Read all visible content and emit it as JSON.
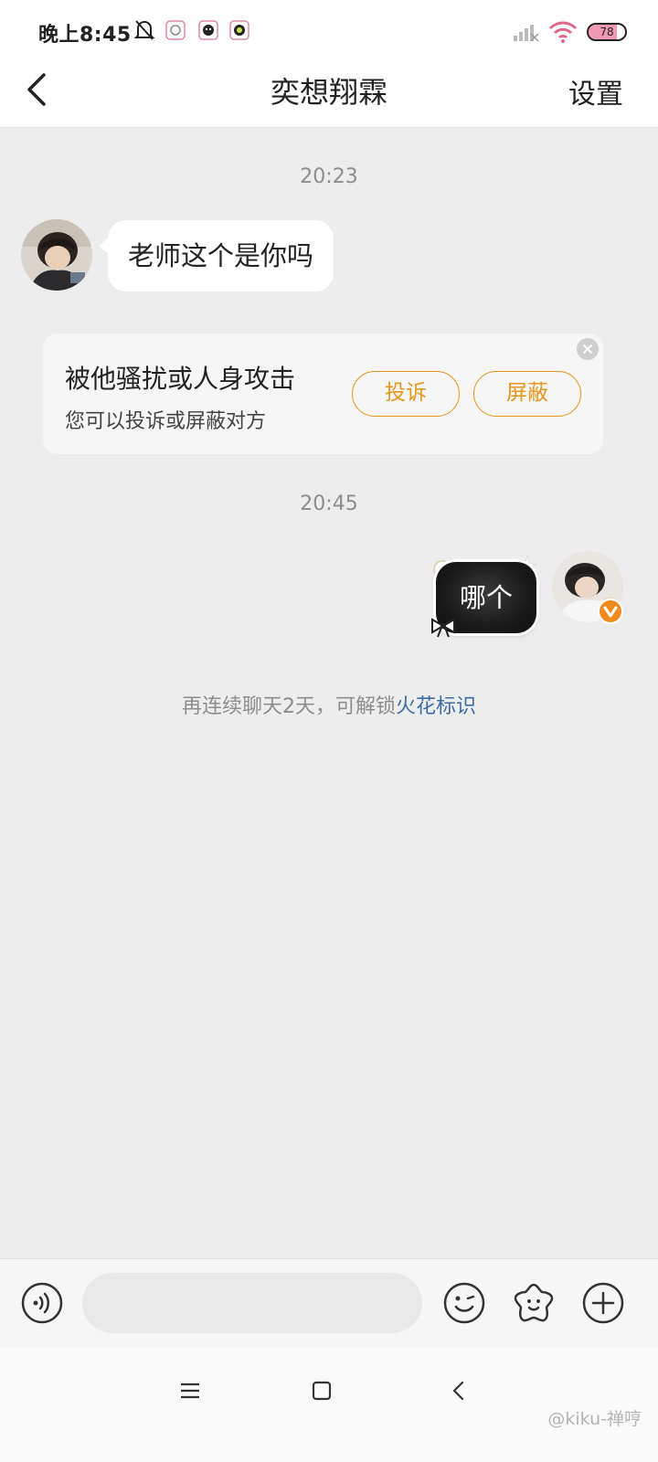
{
  "status_bar": {
    "time": "晚上8:45",
    "battery_level": "78",
    "battery_fraction": 0.78,
    "icons": [
      "bell-off-icon",
      "app-notification-icon",
      "app-notification-icon",
      "app-notification-icon",
      "signal-icon",
      "wifi-icon",
      "battery-icon"
    ]
  },
  "header": {
    "back_icon": "chevron-left-icon",
    "title": "奕想翔霖",
    "settings_label": "设置"
  },
  "chat": {
    "timestamp_1": "20:23",
    "incoming_message": "老师这个是你吗",
    "report_card": {
      "title": "被他骚扰或人身攻击",
      "subtitle": "您可以投诉或屏蔽对方",
      "complain_label": "投诉",
      "block_label": "屏蔽"
    },
    "timestamp_2": "20:45",
    "outgoing_message": "哪个",
    "spark_hint_prefix": "再连续聊天2天，可解锁",
    "spark_hint_link": "火花标识"
  },
  "input_bar": {
    "icons": [
      "voice-icon",
      "emoji-icon",
      "sticker-icon",
      "plus-icon"
    ],
    "placeholder": ""
  },
  "nav_bar": {
    "icons": [
      "menu-icon",
      "home-icon",
      "back-icon"
    ],
    "watermark": "@kiku-禅哼"
  },
  "colors": {
    "accent_orange": "#e9941a",
    "link_blue": "#3d6da5",
    "background": "#ededed",
    "verified_badge": "#f08a1c"
  }
}
